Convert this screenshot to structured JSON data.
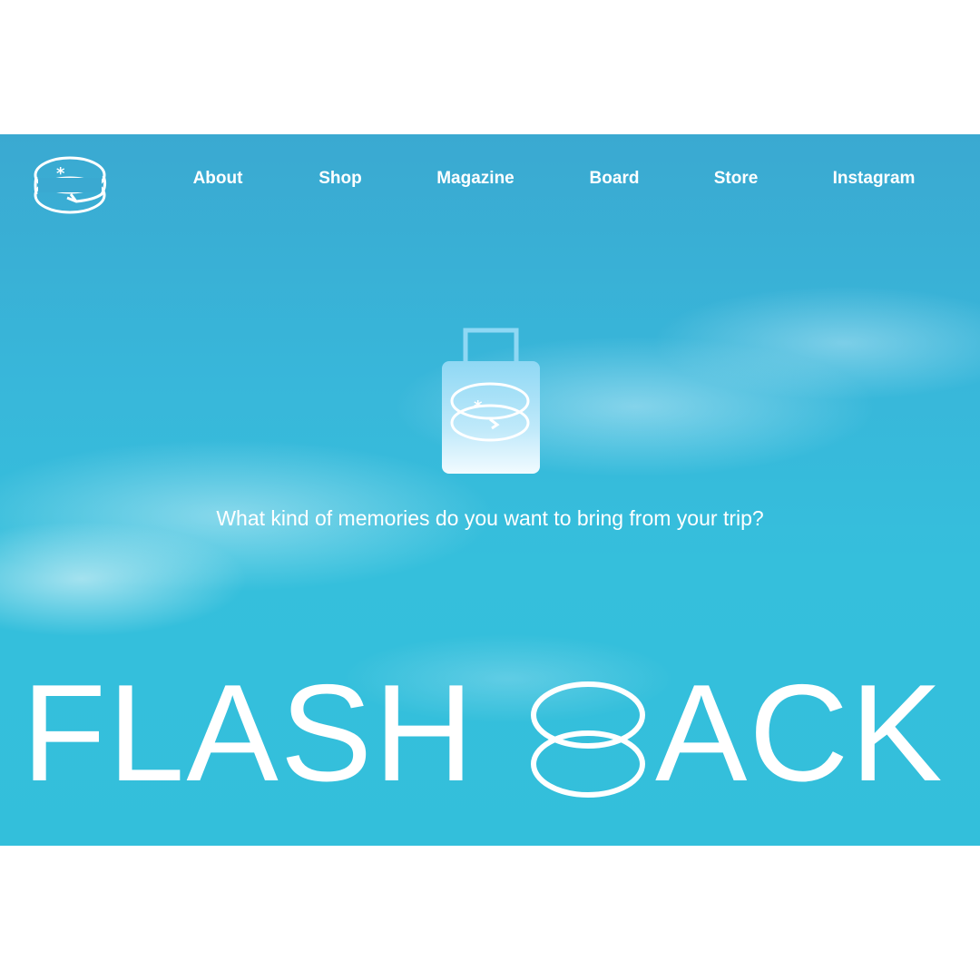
{
  "nav": {
    "items": [
      {
        "label": "About"
      },
      {
        "label": "Shop"
      },
      {
        "label": "Magazine"
      },
      {
        "label": "Board"
      },
      {
        "label": "Store"
      },
      {
        "label": "Instagram"
      }
    ]
  },
  "hero": {
    "tagline": "What kind of memories do you want to bring from your trip?",
    "title_left": "FLASH",
    "title_right": "ACK"
  },
  "icons": {
    "logo": "flashback-logo-icon",
    "suitcase": "suitcase-icon",
    "title_logo": "flashback-rings-logo-icon"
  },
  "colors": {
    "sky": "#35bfdc",
    "text": "#ffffff"
  }
}
